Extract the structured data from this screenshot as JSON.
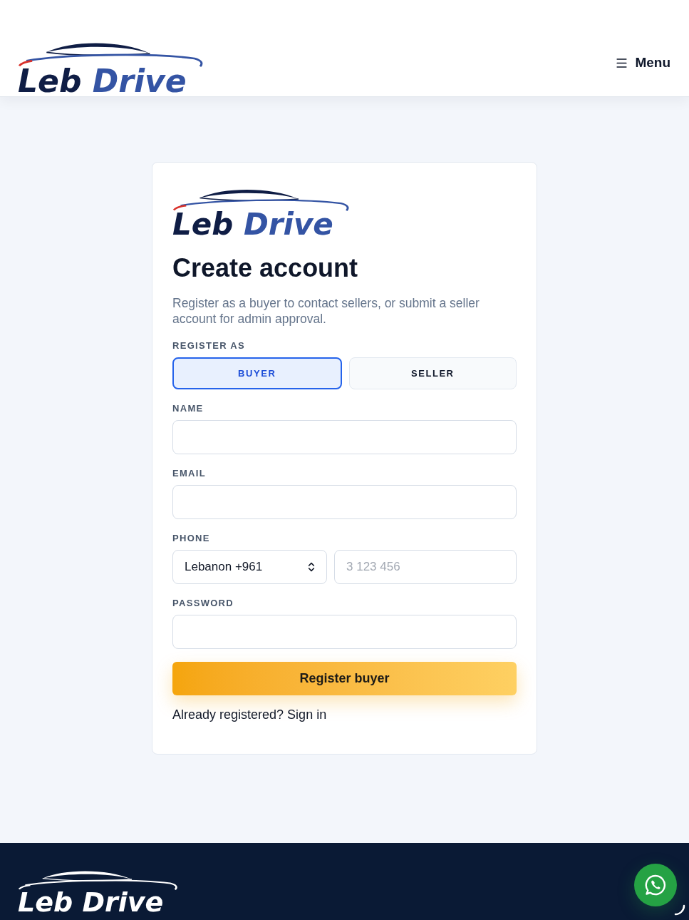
{
  "header": {
    "logo": {
      "word_1": "Leb",
      "word_2": "Drive"
    },
    "menu_button": {
      "label": "Menu"
    }
  },
  "card": {
    "logo": {
      "word_1": "Leb",
      "word_2": "Drive"
    },
    "title": "Create account",
    "description": "Register as a buyer to contact sellers, or submit a seller account for admin approval.",
    "role_label": "REGISTER AS",
    "roles": [
      {
        "label": "BUYER",
        "selected": true
      },
      {
        "label": "SELLER",
        "selected": false
      }
    ],
    "fields": [
      {
        "label": "NAME",
        "kind": "text"
      },
      {
        "label": "EMAIL",
        "kind": "email"
      },
      {
        "label": "PHONE",
        "kind": "phone",
        "country": "Lebanon +961",
        "placeholder": "3 123 456"
      },
      {
        "label": "PASSWORD",
        "kind": "password"
      }
    ],
    "submit": "Register buyer",
    "signin_prompt": "Already registered?",
    "signin_link": "Sign in"
  },
  "footer": {
    "logo": {
      "word_1": "Leb",
      "word_2": "Drive"
    }
  }
}
